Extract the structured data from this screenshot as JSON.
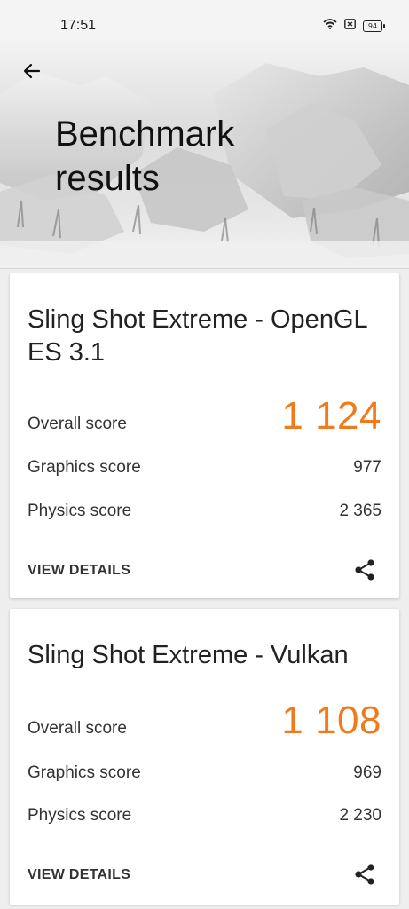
{
  "status": {
    "time": "17:51",
    "battery": "94"
  },
  "header": {
    "title": "Benchmark results"
  },
  "results": [
    {
      "title": "Sling Shot Extreme - OpenGL ES 3.1",
      "overall_label": "Overall score",
      "overall_value": "1 124",
      "graphics_label": "Graphics score",
      "graphics_value": "977",
      "physics_label": "Physics score",
      "physics_value": "2 365",
      "details_label": "VIEW DETAILS"
    },
    {
      "title": "Sling Shot Extreme - Vulkan",
      "overall_label": "Overall score",
      "overall_value": "1 108",
      "graphics_label": "Graphics score",
      "graphics_value": "969",
      "physics_label": "Physics score",
      "physics_value": "2 230",
      "details_label": "VIEW DETAILS"
    }
  ],
  "colors": {
    "accent": "#f07b1d"
  }
}
